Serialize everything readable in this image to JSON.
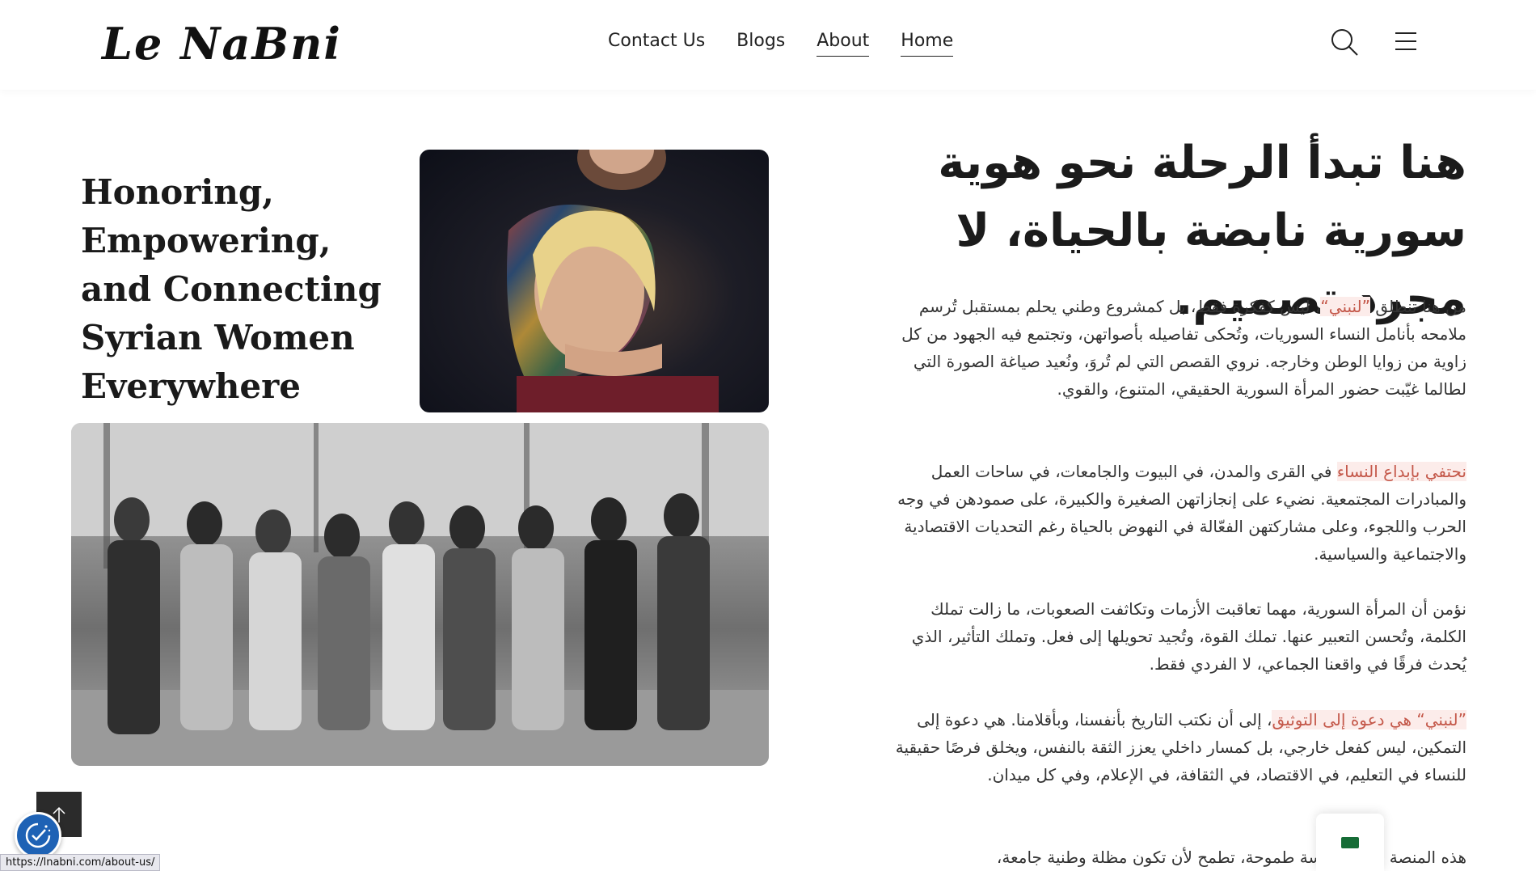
{
  "header": {
    "logo_text": "Le NaBni",
    "nav": [
      {
        "label": "Contact Us"
      },
      {
        "label": "Blogs"
      },
      {
        "label": "About"
      },
      {
        "label": "Home"
      }
    ]
  },
  "hero": {
    "title": "Honoring, Empowering, and Connecting Syrian Women Everywhere"
  },
  "content": {
    "heading": "هنا تبدأ الرحلة نحو هوية سورية نابضة بالحياة، لا مجرد تصميم.",
    "p1_before": "من هنا تنطلق ",
    "p1_highlight": "”لنبني“",
    "p1_after": "، ليس كفكرة فقط، بل كمشروع وطني يحلم بمستقبل تُرسم ملامحه بأنامل النساء السوريات، وتُحكى تفاصيله بأصواتهن، وتجتمع فيه الجهود من كل زاوية من زوايا الوطن وخارجه. نروي القصص التي لم تُروَ، ونُعيد صياغة الصورة التي لطالما غيّبت حضور المرأة السورية الحقيقي، المتنوع، والقوي.",
    "p2_highlight": "نحتفي بإبداع النساء",
    "p2_after": " في القرى والمدن، في البيوت والجامعات، في ساحات العمل والمبادرات المجتمعية. نضيء على إنجازاتهن الصغيرة والكبيرة، على صمودهن في وجه الحرب واللجوء، وعلى مشاركتهن الفعّالة في النهوض بالحياة رغم التحديات الاقتصادية والاجتماعية والسياسية.",
    "p3": "نؤمن أن المرأة السورية، مهما تعاقبت الأزمات وتكاثفت الصعوبات، ما زالت تملك الكلمة، وتُحسن التعبير عنها. تملك القوة، وتُجيد تحويلها إلى فعل. وتملك التأثير، الذي يُحدث فرقًا في واقعنا الجماعي، لا الفردي فقط.",
    "p4_highlight": "”لنبني“ هي دعوة إلى التوثيق",
    "p4_after": "، إلى أن نكتب التاريخ بأنفسنا، وبأقلامنا. هي دعوة إلى التمكين، ليس كفعل خارجي، بل كمسار داخلي يعزز الثقة بالنفس، ويخلق فرصًا حقيقية للنساء في التعليم، في الاقتصاد، في الثقافة، في الإعلام، وفي كل ميدان.",
    "p5": "هذه المنصة نواة مؤسسة طموحة، تطمح لأن تكون مظلة وطنية جامعة،"
  },
  "status_bar": {
    "url": "https://lnabni.com/about-us/"
  },
  "icons": {
    "search": "search-icon",
    "menu": "hamburger-icon",
    "scroll_top": "arrow-up-icon",
    "cookie": "cookie-consent-icon",
    "language": "saudi-flag-icon"
  },
  "colors": {
    "highlight_text": "#c4584a",
    "highlight_bg": "#fcecea",
    "scroll_top_bg": "#2b2b2b",
    "cookie_bg": "#1e62b5"
  }
}
